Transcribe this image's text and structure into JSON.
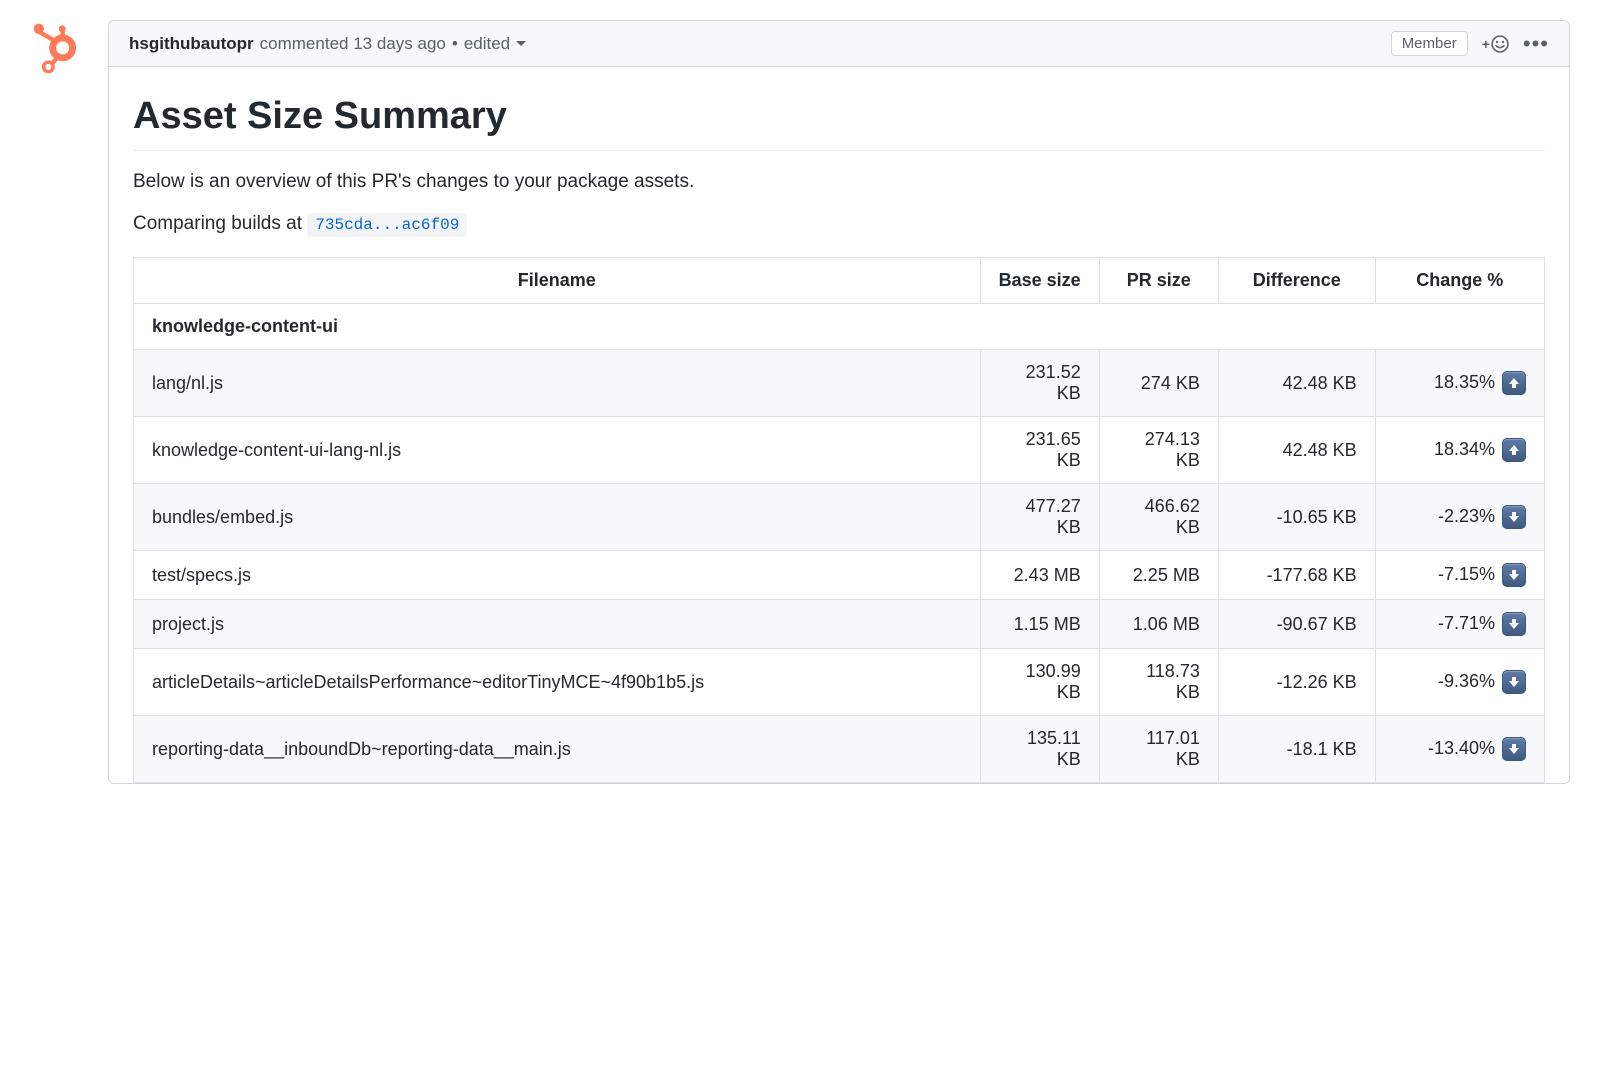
{
  "comment": {
    "user": "hsgithubautopr",
    "action": "commented",
    "timestamp": "13 days ago",
    "edited_label": "edited",
    "badge": "Member"
  },
  "body": {
    "title": "Asset Size Summary",
    "intro": "Below is an overview of this PR's changes to your package assets.",
    "comparing_prefix": "Comparing builds at ",
    "build_ref": "735cda...ac6f09"
  },
  "table": {
    "headers": {
      "filename": "Filename",
      "base": "Base size",
      "pr": "PR size",
      "diff": "Difference",
      "change": "Change %"
    },
    "group": "knowledge-content-ui",
    "rows": [
      {
        "filename": "lang/nl.js",
        "base": "231.52 KB",
        "pr": "274 KB",
        "diff": "42.48 KB",
        "change": "18.35%",
        "dir": "up"
      },
      {
        "filename": "knowledge-content-ui-lang-nl.js",
        "base": "231.65 KB",
        "pr": "274.13 KB",
        "diff": "42.48 KB",
        "change": "18.34%",
        "dir": "up"
      },
      {
        "filename": "bundles/embed.js",
        "base": "477.27 KB",
        "pr": "466.62 KB",
        "diff": "-10.65 KB",
        "change": "-2.23%",
        "dir": "down"
      },
      {
        "filename": "test/specs.js",
        "base": "2.43 MB",
        "pr": "2.25 MB",
        "diff": "-177.68 KB",
        "change": "-7.15%",
        "dir": "down"
      },
      {
        "filename": "project.js",
        "base": "1.15 MB",
        "pr": "1.06 MB",
        "diff": "-90.67 KB",
        "change": "-7.71%",
        "dir": "down"
      },
      {
        "filename": "articleDetails~articleDetailsPerformance~editorTinyMCE~4f90b1b5.js",
        "base": "130.99 KB",
        "pr": "118.73 KB",
        "diff": "-12.26 KB",
        "change": "-9.36%",
        "dir": "down"
      },
      {
        "filename": "reporting-data__inboundDb~reporting-data__main.js",
        "base": "135.11 KB",
        "pr": "117.01 KB",
        "diff": "-18.1 KB",
        "change": "-13.40%",
        "dir": "down"
      }
    ]
  }
}
